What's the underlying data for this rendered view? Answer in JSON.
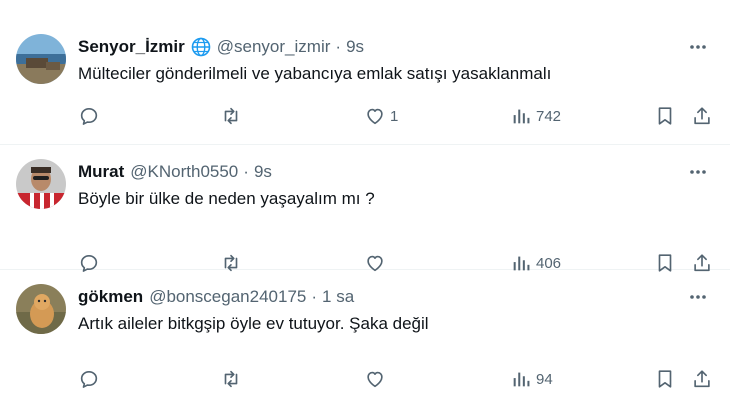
{
  "tweets": [
    {
      "name": "Senyor_İzmir",
      "handle": "@senyor_izmir",
      "time": "9s",
      "text": "Mülteciler gönderilmeli ve yabancıya emlak satışı yasaklanmalı",
      "likes": "1",
      "views": "742",
      "has_globe": true
    },
    {
      "name": "Murat",
      "handle": "@KNorth0550",
      "time": "9s",
      "text": "Böyle bir ülke de neden yaşayalım mı ?",
      "likes": "",
      "views": "406",
      "has_globe": false
    },
    {
      "name": "gökmen",
      "handle": "@bonscegan240175",
      "time": "1 sa",
      "text": "Artık aileler bitkgşip öyle ev tutuyor. Şaka değil",
      "likes": "",
      "views": "94",
      "has_globe": false
    }
  ],
  "separator": "·",
  "colors": {
    "text": "#0f1419",
    "secondary": "#536471",
    "border": "#eff3f4"
  },
  "icons": [
    "reply-icon",
    "retweet-icon",
    "like-icon",
    "views-icon",
    "bookmark-icon",
    "share-icon",
    "more-icon",
    "globe-icon"
  ]
}
